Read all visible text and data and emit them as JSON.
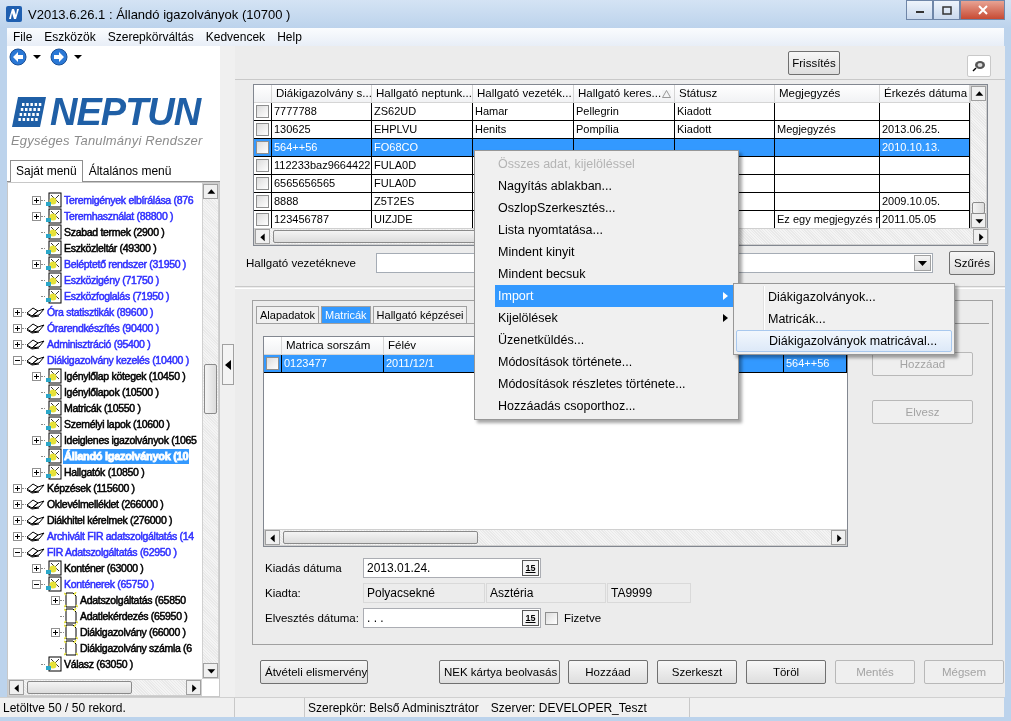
{
  "window": {
    "title": "V2013.6.26.1 : Állandó igazolványok (10700 )"
  },
  "menu_bar": [
    "File",
    "Eszközök",
    "Szerepkörváltás",
    "Kedvencek",
    "Help"
  ],
  "logo": {
    "name": "NEPTUN",
    "tagline": "Egységes Tanulmányi Rendszer"
  },
  "side_tabs": [
    {
      "label": "Saját menü",
      "selected": true
    },
    {
      "label": "Általános menü",
      "selected": false
    }
  ],
  "tree": {
    "continued_items": [
      {
        "label": "Teremigények elbírálása (876",
        "kind": "module",
        "color": "#3030ff",
        "selected": false,
        "expanded": false
      },
      {
        "label": "Teremhasználat (88800 )",
        "kind": "module",
        "color": "#3030ff",
        "selected": false,
        "expanded": false
      },
      {
        "label": "Szabad termek (2900 )",
        "kind": "module",
        "color": "#000000",
        "selected": false
      },
      {
        "label": "Eszközleltár (49300 )",
        "kind": "module",
        "color": "#000000",
        "selected": false
      },
      {
        "label": "Beléptető rendszer (31950 )",
        "kind": "module",
        "color": "#3030ff",
        "selected": false,
        "expanded": false
      },
      {
        "label": "Eszközigény (71750 )",
        "kind": "module",
        "color": "#3030ff",
        "selected": false
      },
      {
        "label": "Eszközfoglalás (71950 )",
        "kind": "module",
        "color": "#3030ff",
        "selected": false
      }
    ],
    "items": [
      {
        "label": "Óra statisztikák (89600 )",
        "kind": "book",
        "color": "#3030ff",
        "selected": false,
        "expanded": false
      },
      {
        "label": "Órarendkészítés (90400 )",
        "kind": "book",
        "color": "#3030ff",
        "selected": false,
        "expanded": false
      },
      {
        "label": "Adminisztráció (95400 )",
        "kind": "book",
        "color": "#3030ff",
        "selected": false,
        "expanded": false
      },
      {
        "label": "Diákigazolvány kezelés (10400 )",
        "kind": "book",
        "color": "#3030ff",
        "selected": false,
        "expanded": true,
        "children": [
          {
            "label": "Igénylőlap kötegek (10450 )",
            "kind": "module",
            "color": "#000000",
            "selected": false,
            "expanded": false
          },
          {
            "label": "Igénylőlapok (10500 )",
            "kind": "module",
            "color": "#000000",
            "selected": false
          },
          {
            "label": "Matricák (10550 )",
            "kind": "module",
            "color": "#000000",
            "selected": false
          },
          {
            "label": "Személyi lapok (10600 )",
            "kind": "module",
            "color": "#000000",
            "selected": false
          },
          {
            "label": "Ideiglenes igazolványok (1065",
            "kind": "module",
            "color": "#000000",
            "selected": false,
            "expanded": false
          },
          {
            "label": "Állandó igazolványok (10",
            "kind": "module",
            "selected": true
          },
          {
            "label": "Hallgatók (10850 )",
            "kind": "module",
            "color": "#000000",
            "selected": false,
            "expanded": false
          }
        ]
      },
      {
        "label": "Képzések (115600 )",
        "kind": "book",
        "color": "#000000",
        "selected": false,
        "expanded": false
      },
      {
        "label": "Oklevélmelléklet (266000 )",
        "kind": "book",
        "color": "#000000",
        "selected": false,
        "expanded": false
      },
      {
        "label": "Diákhitel kérelmek (276000 )",
        "kind": "book",
        "color": "#000000",
        "selected": false,
        "expanded": false
      },
      {
        "label": "Archivált FIR adatszolgáltatás (14",
        "kind": "book",
        "color": "#3030ff",
        "selected": false,
        "expanded": false
      },
      {
        "label": "FIR Adatszolgáltatás (62950 )",
        "kind": "book",
        "color": "#3030ff",
        "selected": false,
        "expanded": true,
        "children": [
          {
            "label": "Konténer (63000 )",
            "kind": "module",
            "color": "#000000",
            "selected": false,
            "expanded": false
          },
          {
            "label": "Konténerek (65750 )",
            "kind": "module",
            "color": "#3030ff",
            "selected": false,
            "expanded": true,
            "children": [
              {
                "label": "Adatszolgáltatás (65850",
                "kind": "page",
                "color": "#000000",
                "selected": false,
                "expanded": false
              },
              {
                "label": "Adatlekérdezés (65950 )",
                "kind": "page",
                "color": "#000000",
                "selected": false
              },
              {
                "label": "Diákigazolvány (66000 )",
                "kind": "page",
                "color": "#000000",
                "selected": false,
                "expanded": false
              },
              {
                "label": "Diákigazolvány számla (6",
                "kind": "page",
                "color": "#000000",
                "selected": false
              }
            ]
          },
          {
            "label": "Válasz (63050 )",
            "kind": "module",
            "color": "#000000",
            "selected": false
          }
        ]
      }
    ]
  },
  "toolbar": {
    "refresh_button": "Frissítés"
  },
  "grid": {
    "columns": [
      {
        "label": "Diákigazolvány s...",
        "sorted": false
      },
      {
        "label": "Hallgató neptunk...",
        "sorted": false
      },
      {
        "label": "Hallgató vezeték...",
        "sorted": false
      },
      {
        "label": "Hallgató keres...",
        "sorted": true
      },
      {
        "label": "Státusz",
        "sorted": false
      },
      {
        "label": "Megjegyzés",
        "sorted": false
      },
      {
        "label": "Érkezés dátuma",
        "sorted": false
      }
    ],
    "rows": [
      {
        "checked": false,
        "selected": false,
        "cells": [
          "7777788",
          "ZS62UD",
          "Hamar",
          "Pellegrin",
          "Kiadott",
          null,
          null
        ]
      },
      {
        "checked": false,
        "selected": false,
        "cells": [
          "130625",
          "EHPLVU",
          "Henits",
          "Pompília",
          "Kiadott",
          "Megjegyzés",
          "2013.06.25."
        ]
      },
      {
        "checked": false,
        "selected": true,
        "cells": [
          "564++56",
          "FO68CO",
          null,
          null,
          null,
          null,
          "2010.10.13."
        ]
      },
      {
        "checked": false,
        "selected": false,
        "cells": [
          "112233baz9664422",
          "FULA0D",
          null,
          null,
          null,
          null,
          null
        ]
      },
      {
        "checked": false,
        "selected": false,
        "cells": [
          "6565656565",
          "FULA0D",
          null,
          null,
          null,
          null,
          null
        ]
      },
      {
        "checked": false,
        "selected": false,
        "cells": [
          "8888",
          "Z5T2ES",
          null,
          null,
          null,
          null,
          "2009.10.05."
        ]
      },
      {
        "checked": false,
        "selected": false,
        "cells": [
          "123456787",
          "UIZJDE",
          null,
          null,
          null,
          "Ez egy megjegyzés r",
          "2011.05.05"
        ]
      }
    ]
  },
  "filter": {
    "label": "Hallgató vezetékneve",
    "button": "Szűrés"
  },
  "detail_tabs": [
    {
      "label": "Alapadatok",
      "selected": false
    },
    {
      "label": "Matricák",
      "selected": true
    },
    {
      "label": "Hallgató képzései",
      "selected": false
    }
  ],
  "sticker_grid": {
    "columns": [
      "Matrica sorszám",
      "Félév",
      null,
      null
    ],
    "rows": [
      {
        "checked": false,
        "selected": true,
        "cells": [
          "0123477",
          "2011/12/1",
          null,
          "564++56"
        ]
      }
    ]
  },
  "side_buttons": [
    {
      "label": "Hozzáad",
      "disabled": true
    },
    {
      "label": "Elvesz",
      "disabled": true
    }
  ],
  "fields": {
    "issue_date": {
      "label": "Kiadás dátuma",
      "value": "2013.01.24.",
      "calendar": "15"
    },
    "issued_by": {
      "label": "Kiadta:",
      "values": [
        "Polyacsekné",
        "Asztéria",
        "TA9999"
      ]
    },
    "loss_date": {
      "label": "Elvesztés dátuma:",
      "value": ". . .",
      "calendar": "15"
    },
    "paid": {
      "label": "Fizetve",
      "checked": false
    }
  },
  "buttons": [
    {
      "label": "Átvételi elismervény",
      "disabled": false
    },
    {
      "label": "NEK kártya beolvasás",
      "disabled": false
    },
    {
      "label": "Hozzáad",
      "disabled": false
    },
    {
      "label": "Szerkeszt",
      "disabled": false
    },
    {
      "label": "Töröl",
      "disabled": false
    },
    {
      "label": "Mentés",
      "disabled": true
    },
    {
      "label": "Mégsem",
      "disabled": true
    }
  ],
  "status_bar": {
    "records": "Letöltve 50 / 50 rekord.",
    "role": "Szerepkör: Belső Adminisztrátor",
    "server": "Szerver: DEVELOPER_Teszt"
  },
  "context_menu": {
    "items": [
      {
        "label": "Összes adat, kijelöléssel",
        "disabled": true,
        "selected": false,
        "submenu": false
      },
      {
        "label": "Nagyítás ablakban...",
        "disabled": false,
        "selected": false,
        "submenu": false
      },
      {
        "label": "OszlopSzerkesztés...",
        "disabled": false,
        "selected": false,
        "submenu": false
      },
      {
        "label": "Lista nyomtatása...",
        "disabled": false,
        "selected": false,
        "submenu": false
      },
      {
        "label": "Mindent kinyit",
        "disabled": false,
        "selected": false,
        "submenu": false
      },
      {
        "label": "Mindent becsuk",
        "disabled": false,
        "selected": false,
        "submenu": false
      },
      {
        "label": "Import",
        "disabled": false,
        "selected": true,
        "submenu": true
      },
      {
        "label": "Kijelölések",
        "disabled": false,
        "selected": false,
        "submenu": true
      },
      {
        "label": "Üzenetküldés...",
        "disabled": false,
        "selected": false,
        "submenu": false
      },
      {
        "label": "Módosítások története...",
        "disabled": false,
        "selected": false,
        "submenu": false
      },
      {
        "label": "Módosítások részletes története...",
        "disabled": false,
        "selected": false,
        "submenu": false
      },
      {
        "label": "Hozzáadás csoporthoz...",
        "disabled": false,
        "selected": false,
        "submenu": false
      }
    ]
  },
  "submenu": {
    "items": [
      {
        "label": "Diákigazolványok...",
        "selected": false
      },
      {
        "label": "Matricák...",
        "selected": false
      },
      {
        "label": "Diákigazolványok matricával...",
        "selected": true
      }
    ]
  }
}
